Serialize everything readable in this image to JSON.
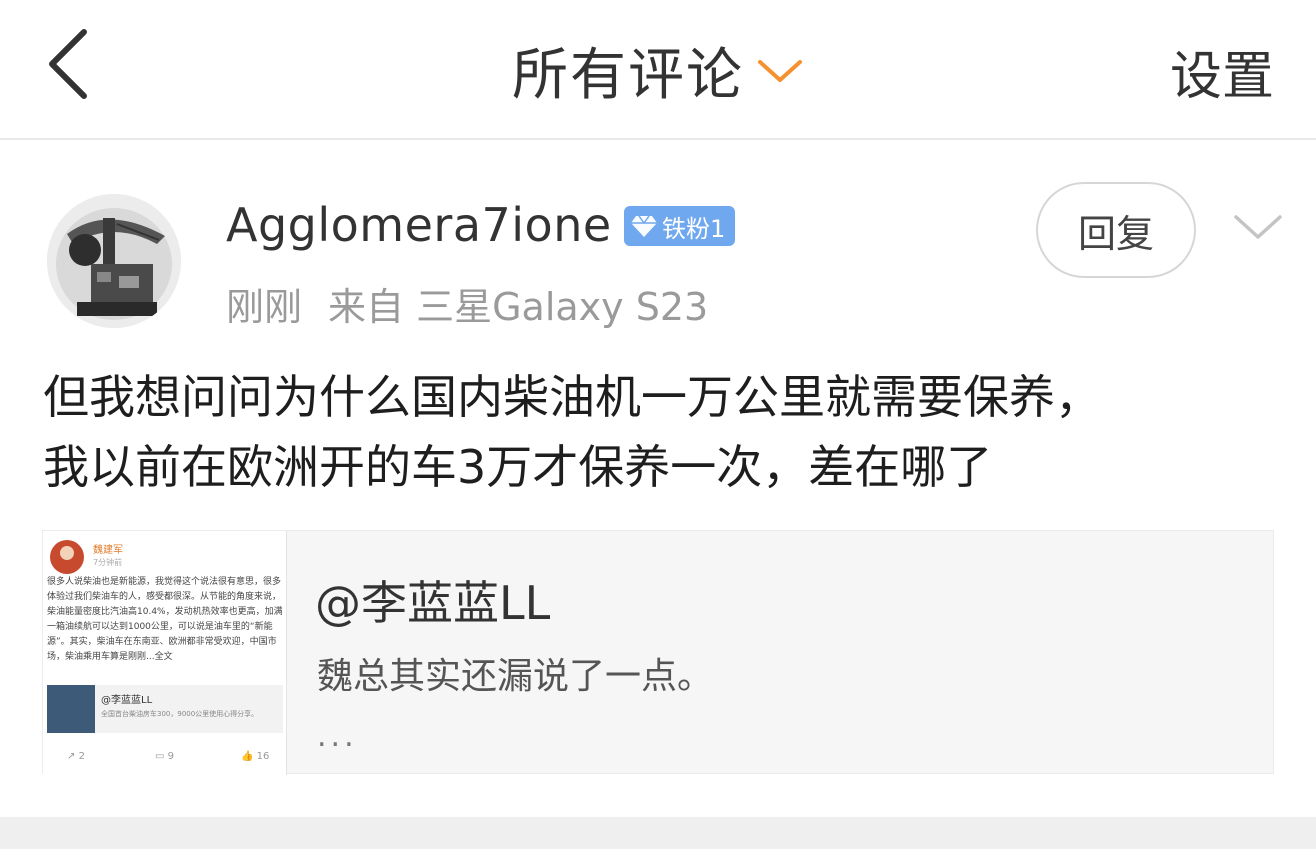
{
  "header": {
    "back_icon": "chevron-left-icon",
    "title": "所有评论",
    "title_chevron_icon": "chevron-down-icon",
    "accent_color": "#f5922f",
    "settings_label": "设置"
  },
  "comment": {
    "username": "Agglomera7ione",
    "badge_label": "铁粉1",
    "badge_icon": "diamond-icon",
    "badge_color": "#6fa8ee",
    "time": "刚刚",
    "source": "来自 三星Galaxy S23",
    "reply_label": "回复",
    "more_icon": "chevron-down-icon",
    "text_line1": "但我想问问为什么国内柴油机一万公里就需要保养，",
    "text_line2": "我以前在欧洲开的车3万才保养一次，差在哪了"
  },
  "quoted": {
    "user": "@李蓝蓝LL",
    "text": "魏总其实还漏说了一点。",
    "ellipsis": "...",
    "thumbnail": {
      "name": "魏建军",
      "time": "7分钟前",
      "body": "很多人说柴油也是新能源，我觉得这个说法很有意思，很多体验过我们柴油车的人，感受都很深。从节能的角度来说，柴油能量密度比汽油高10.4%，发动机热效率也更高，加满一箱油续航可以达到1000公里，可以说是油车里的“新能源”。其实，柴油车在东南亚、欧洲都非常受欢迎，中国市场，柴油乘用车算是刚刚...全文",
      "card_user": "@李蓝蓝LL",
      "card_text": "全国首台柴油房车300，9000公里使用心得分享。",
      "stat_repost": "2",
      "stat_comment": "9",
      "stat_like": "16"
    }
  }
}
